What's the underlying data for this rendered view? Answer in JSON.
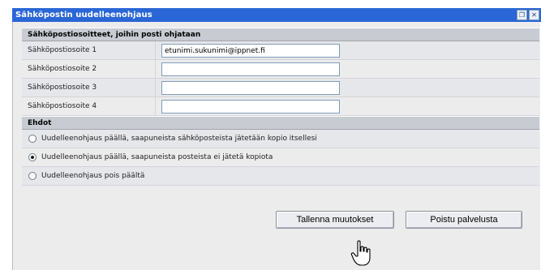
{
  "window": {
    "title": "Sähköpostin uudelleenohjaus",
    "buttons": [
      {
        "name": "restore-icon",
        "glyph": "❐"
      },
      {
        "name": "close-icon",
        "glyph": "✕"
      }
    ]
  },
  "addresses_section": {
    "header": "Sähköpostiosoitteet, joihin posti ohjataan",
    "rows": [
      {
        "label": "Sähköpostiosoite 1",
        "value": "etunimi.sukunimi@ippnet.fi"
      },
      {
        "label": "Sähköpostiosoite 2",
        "value": ""
      },
      {
        "label": "Sähköpostiosoite 3",
        "value": ""
      },
      {
        "label": "Sähköpostiosoite 4",
        "value": ""
      }
    ]
  },
  "options_section": {
    "header": "Ehdot",
    "options": [
      {
        "label": "Uudelleenohjaus päällä, saapuneista sähköposteista jätetään kopio itsellesi",
        "checked": false
      },
      {
        "label": "Uudelleenohjaus päällä, saapuneista posteista ei jätetä kopiota",
        "checked": true
      },
      {
        "label": "Uudelleenohjaus pois päältä",
        "checked": false
      }
    ]
  },
  "actions": {
    "save_label": "Tallenna muutokset",
    "exit_label": "Poistu palvelusta"
  },
  "colors": {
    "titlebar": "#2a66d5",
    "panel_bg": "#ececec",
    "header_bg": "#c8ccd2"
  }
}
